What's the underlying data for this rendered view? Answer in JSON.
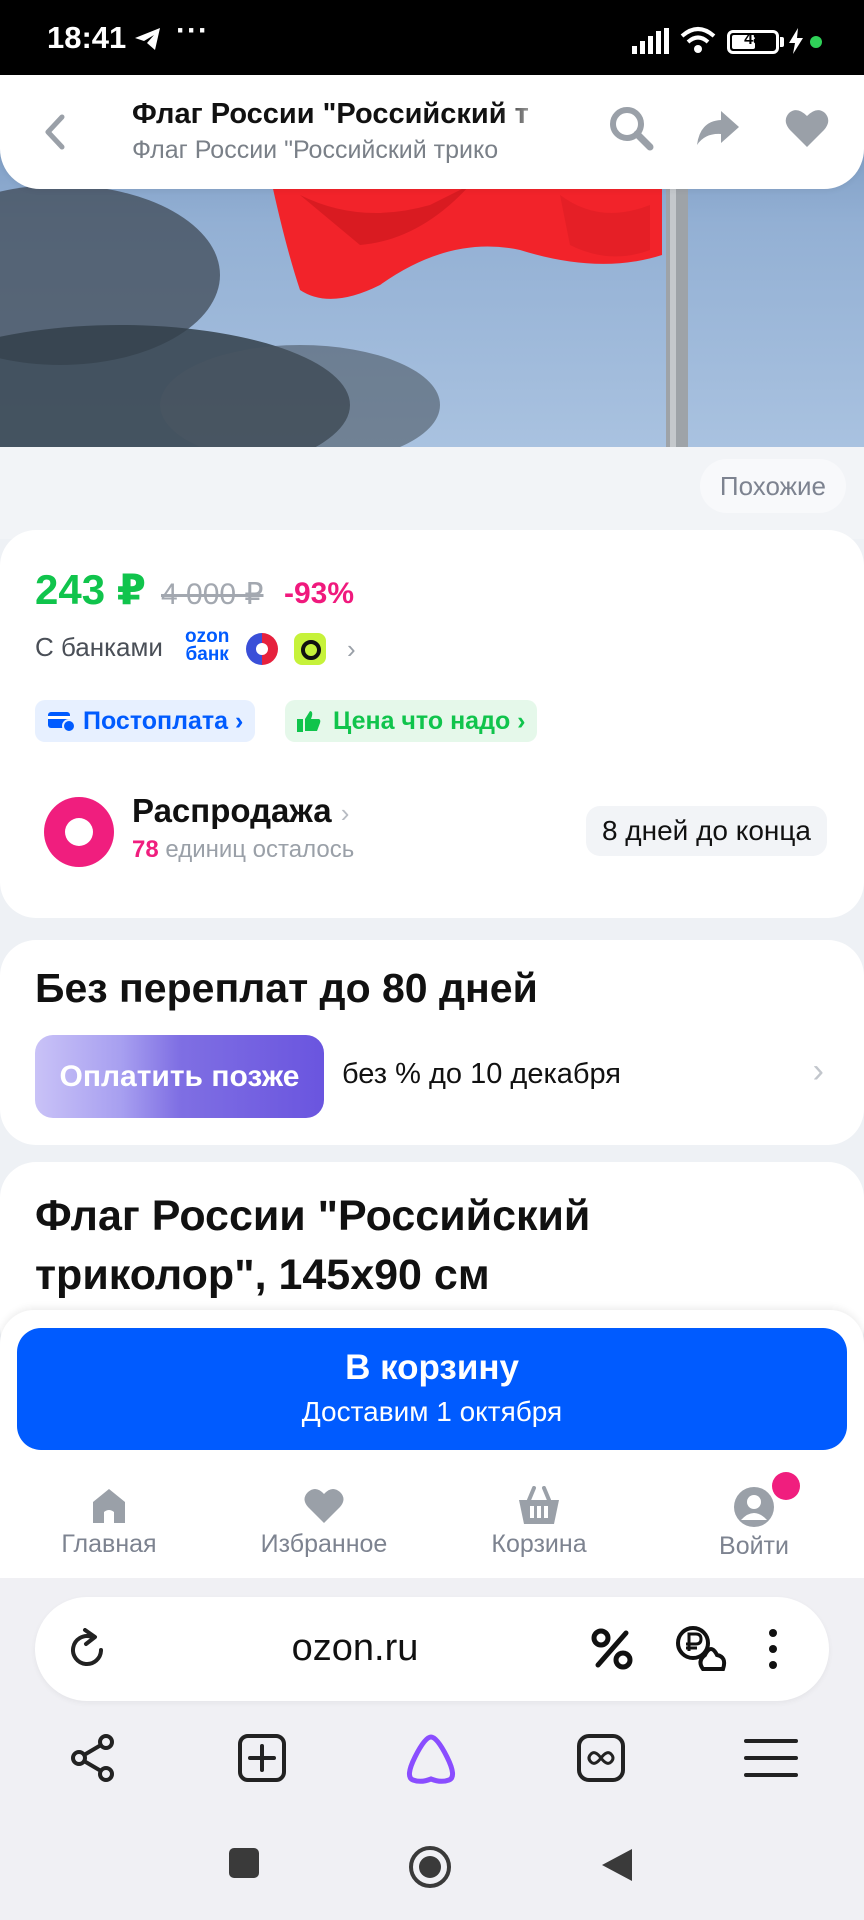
{
  "status_bar": {
    "time": "18:41",
    "battery": "48",
    "more": "···"
  },
  "header": {
    "title": "Флаг России \"Российский т",
    "subtitle": "Флаг России \"Российский трико"
  },
  "similar_label": "Похожие",
  "price": {
    "current": "243 ₽",
    "old": "4 000 ₽",
    "discount": "-93%",
    "banks_label": "С банками",
    "ozon_bank_line1": "ozon",
    "ozon_bank_line2": "банк",
    "badges": [
      {
        "label": "Постоплата ›",
        "icon": "card-clock-icon"
      },
      {
        "label": "Цена что надо ›",
        "icon": "thumbs-up-icon"
      }
    ]
  },
  "sale": {
    "title": "Распродажа",
    "chevron": "›",
    "units_count": "78",
    "units_text": " единиц осталось",
    "days_left": "8 дней до конца"
  },
  "installment": {
    "title": "Без переплат до 80 дней",
    "button": "Оплатить позже",
    "text": "без % до 10 декабря"
  },
  "product_title": "Флаг России \"Российский триколор\", 145х90 см",
  "cart": {
    "label": "В корзину",
    "delivery": "Доставим 1 октября"
  },
  "bottom_nav": [
    {
      "label": "Главная",
      "icon": "home-icon"
    },
    {
      "label": "Избранное",
      "icon": "heart-icon"
    },
    {
      "label": "Корзина",
      "icon": "basket-icon"
    },
    {
      "label": "Войти",
      "icon": "profile-icon"
    }
  ],
  "browser": {
    "url": "ozon.ru"
  },
  "colors": {
    "ozon_blue": "#005bff",
    "price_green": "#10c44c",
    "accent_pink": "#f01e7e",
    "flag_red": "#f2232a"
  }
}
